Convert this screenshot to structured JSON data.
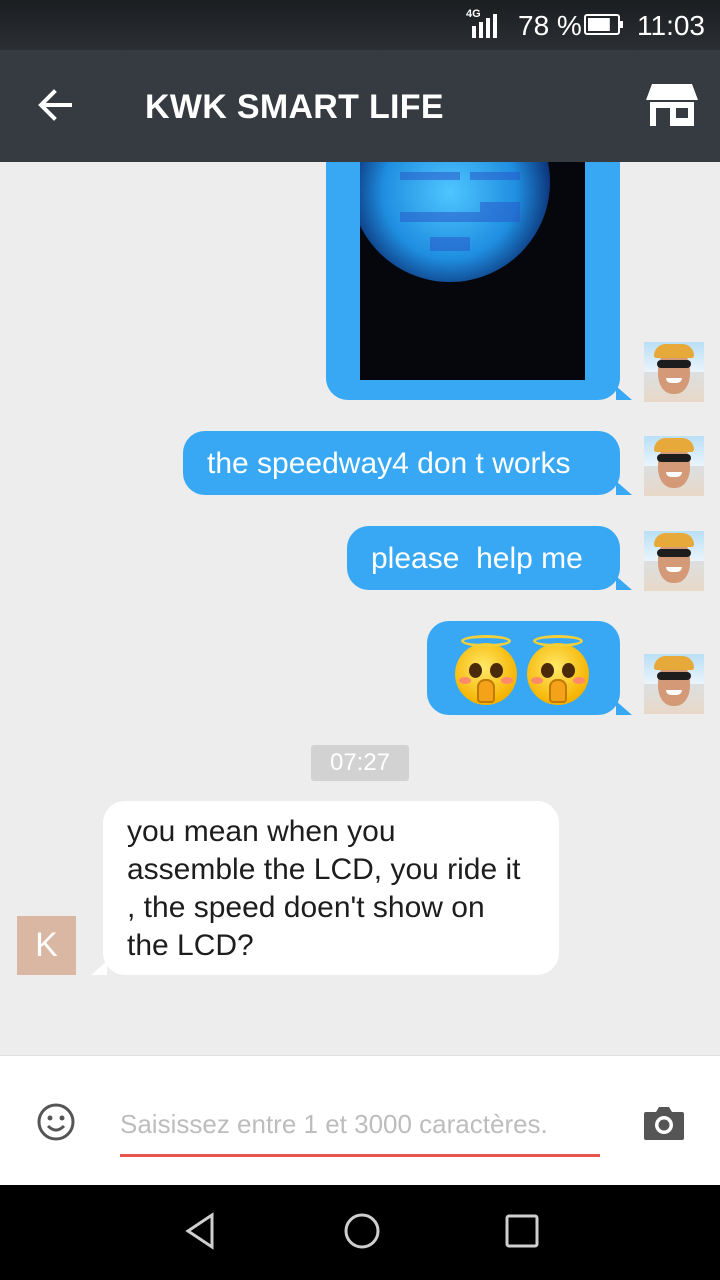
{
  "status_bar": {
    "network": "4G",
    "battery_percent": "78 %",
    "battery_level": 0.78,
    "time": "11:03"
  },
  "header": {
    "title": "KWK SMART LIFE",
    "back_icon": "arrow-left-icon",
    "store_icon": "store-icon"
  },
  "messages": {
    "outgoing": [
      {
        "type": "image",
        "content": "photo of LCD display"
      },
      {
        "type": "text",
        "text": "the speedway4 don t works"
      },
      {
        "type": "text",
        "text": "please  help me"
      },
      {
        "type": "emoji",
        "count": 2,
        "icon": "praying-angel-emoji-icon"
      }
    ],
    "timestamp": "07:27",
    "incoming": {
      "avatar_letter": "K",
      "lines": [
        "you mean when you",
        "assemble the LCD, you ride it",
        ", the speed doen't show on",
        "the LCD?"
      ]
    }
  },
  "input_bar": {
    "placeholder": "Saisissez entre 1 et 3000 caractères.",
    "value": "",
    "emoji_icon": "smiley-icon",
    "camera_icon": "camera-icon"
  },
  "colors": {
    "outgoing_bubble": "#38a8f4",
    "app_bar": "#353b41",
    "input_underline": "#e8554e",
    "avatar_k": "#d9b7a2"
  }
}
